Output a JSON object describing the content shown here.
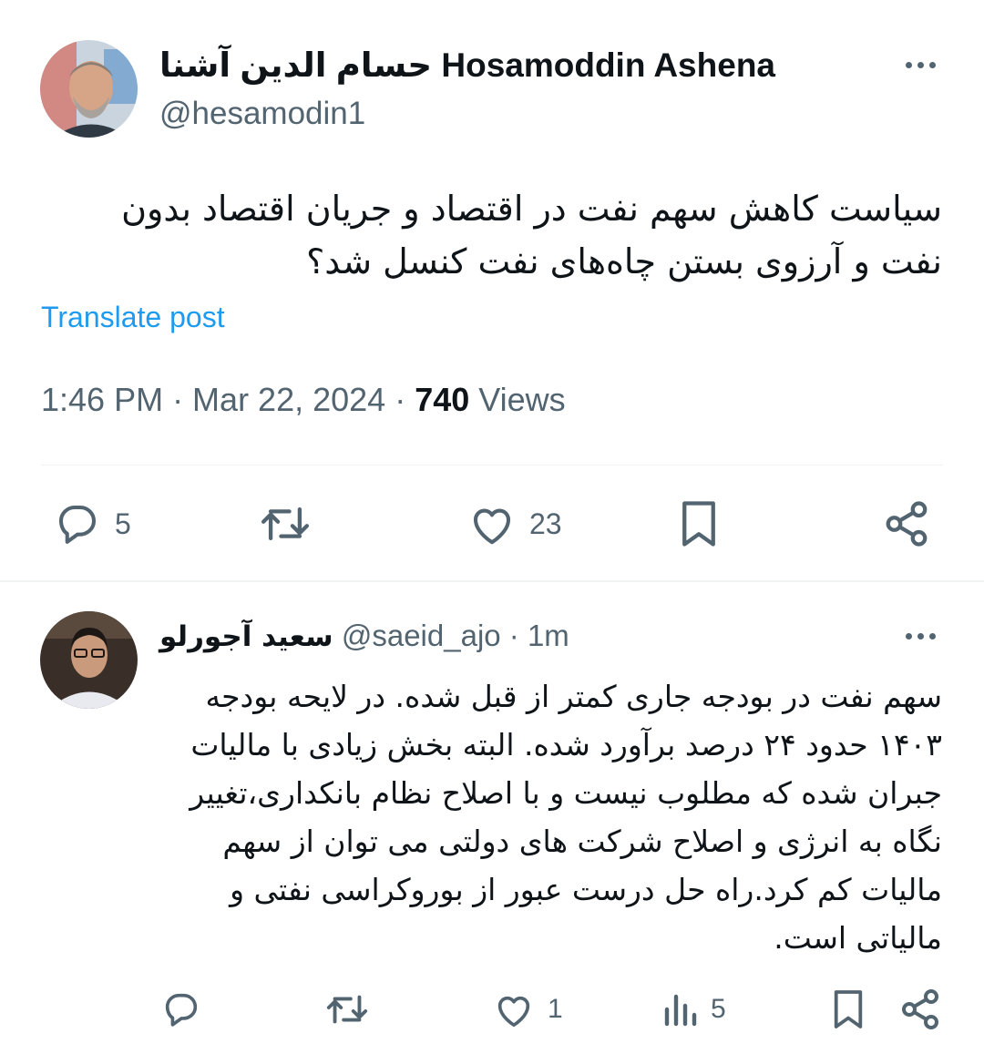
{
  "main_tweet": {
    "author_name": "حسام الدین آشنا Hosamoddin Ashena",
    "handle": "@hesamodin1",
    "text_lines": [
      "سیاست کاهش سهم نفت در اقتصاد  و جریان اقتصاد بدون",
      "نفت و آرزوی بستن چاه‌های نفت کنسل شد؟"
    ],
    "translate_label": "Translate post",
    "timestamp": "1:46 PM · Mar 22, 2024 · ",
    "views_count": "740",
    "views_label": " Views",
    "replies": "5",
    "likes": "23"
  },
  "reply_tweet": {
    "author_name": "سعید آجورلو",
    "handle": "@saeid_ajo",
    "time": " · 1m",
    "text_lines": [
      "سهم نفت در بودجه جاری کمتر از قبل شده. در لایحه بودجه",
      "۱۴۰۳ حدود ۲۴ درصد برآورد شده. البته بخش زیادی با مالیات",
      "جبران شده که مطلوب نیست و با اصلاح نظام بانکداری،تغییر",
      "نگاه به انرژی و اصلاح شرکت های دولتی می توان از سهم",
      "مالیات کم کرد.راه حل درست عبور از بوروکراسی نفتی و",
      "مالیاتی است."
    ],
    "likes": "1",
    "views": "5"
  },
  "colors": {
    "link": "#1d9bf0",
    "secondary_text": "#536471",
    "primary_text": "#0f1419"
  },
  "icons": [
    "more-icon",
    "reply-icon",
    "retweet-icon",
    "like-icon",
    "bookmark-icon",
    "share-icon",
    "views-icon"
  ]
}
